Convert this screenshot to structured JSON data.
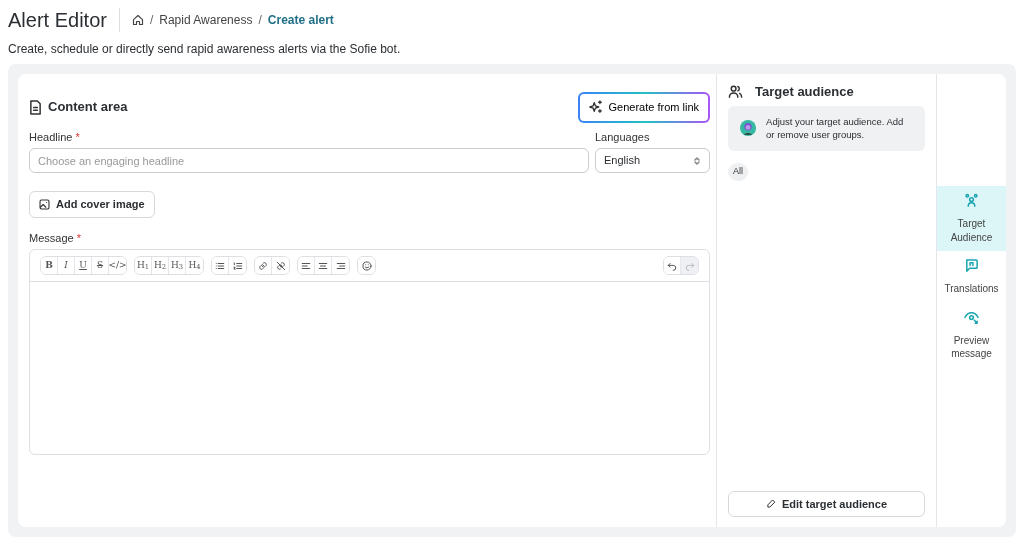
{
  "header": {
    "title": "Alert Editor",
    "breadcrumb": [
      {
        "separator": "/",
        "label": "Rapid Awareness",
        "current": false
      },
      {
        "separator": "/",
        "label": "Create alert",
        "current": true
      }
    ],
    "subtitle": "Create, schedule or directly send rapid awareness alerts via the Sofie bot."
  },
  "content": {
    "title": "Content area",
    "generate_button": "Generate from link",
    "headline": {
      "label": "Headline",
      "required_mark": "*",
      "placeholder": "Choose an engaging headline"
    },
    "languages": {
      "label": "Languages",
      "value": "English"
    },
    "cover_button": "Add cover image",
    "message": {
      "label": "Message",
      "required_mark": "*"
    },
    "toolbar": [
      [
        {
          "kind": "bold",
          "label": "B"
        },
        {
          "kind": "italic",
          "label": "I"
        },
        {
          "kind": "underline",
          "label": "U"
        },
        {
          "kind": "strike",
          "label": "S"
        },
        {
          "kind": "code",
          "label": "</>"
        }
      ],
      [
        {
          "kind": "heading",
          "label": "H$_{1}$"
        },
        {
          "kind": "heading",
          "label": "H$_{2}$"
        },
        {
          "kind": "heading",
          "label": "H$_{3}$"
        },
        {
          "kind": "heading",
          "label": "H$_{4}$"
        }
      ],
      [
        {
          "kind": "bullets"
        },
        {
          "kind": "numbers"
        }
      ],
      [
        {
          "kind": "link"
        },
        {
          "kind": "unlink"
        }
      ],
      [
        {
          "kind": "alignleft"
        },
        {
          "kind": "aligncenter"
        },
        {
          "kind": "alignright"
        }
      ],
      [
        {
          "kind": "emoji"
        }
      ]
    ],
    "history": [
      {
        "kind": "undo",
        "disabled": false
      },
      {
        "kind": "redo",
        "disabled": true
      }
    ]
  },
  "audience": {
    "title": "Target audience",
    "hint": "Adjust your target audience. Add or remove user groups.",
    "tags": [
      "All"
    ],
    "edit_button": "Edit target audience"
  },
  "side_nav": [
    {
      "kind": "people",
      "label": "Target Audience",
      "selected": true
    },
    {
      "kind": "chat",
      "label": "Translations",
      "selected": false
    },
    {
      "kind": "eye",
      "label": "Preview message",
      "selected": false
    }
  ]
}
